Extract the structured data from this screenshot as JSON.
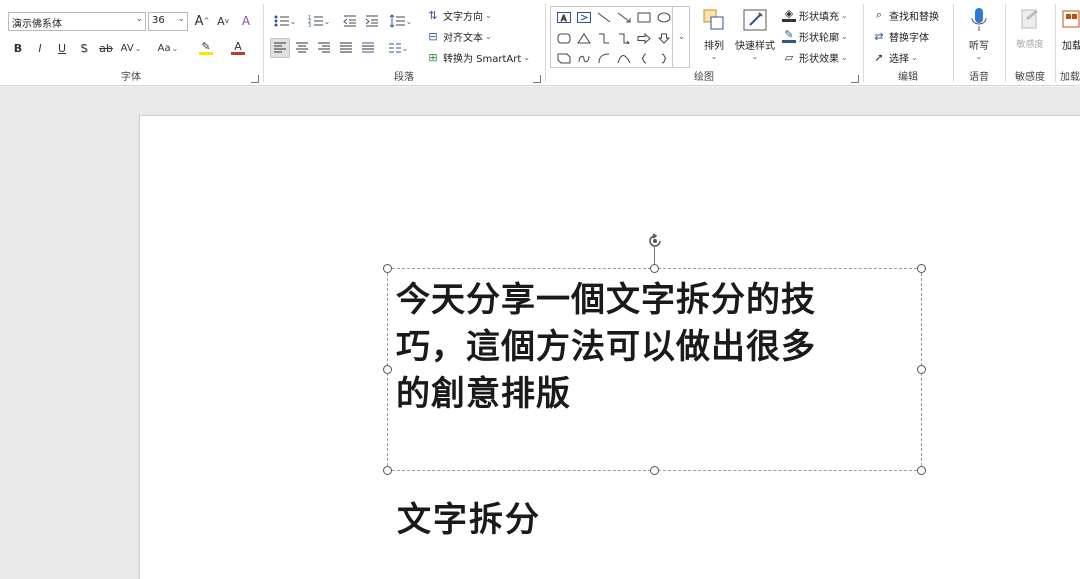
{
  "ribbon": {
    "font": {
      "label": "字体",
      "font_name": "演示佛系体",
      "font_size": "36",
      "grow": "A",
      "shrink": "A",
      "clear": "A",
      "bold": "B",
      "italic": "I",
      "underline": "U",
      "shadow": "S",
      "strike": "ab",
      "spacing": "AV",
      "case": "Aa",
      "highlight": "A",
      "color": "A"
    },
    "paragraph": {
      "label": "段落",
      "text_direction": "文字方向",
      "align_text": "对齐文本",
      "smartart": "转换为 SmartArt"
    },
    "drawing": {
      "label": "绘图",
      "arrange": "排列",
      "quick_styles": "快速样式",
      "shape_fill": "形状填充",
      "shape_outline": "形状轮廓",
      "shape_effects": "形状效果"
    },
    "editing": {
      "label": "编辑",
      "find_replace": "查找和替换",
      "replace_font": "替换字体",
      "select": "选择"
    },
    "voice": {
      "label": "语音",
      "dictate": "听写"
    },
    "sensitivity": {
      "label": "敏感度",
      "button": "敏感度"
    },
    "addins": {
      "label": "加载项",
      "button": "加载项"
    }
  },
  "slide": {
    "textbox_lines": [
      "今天分享一個文字拆分的技",
      "巧，這個方法可以做出很多",
      "的創意排版"
    ],
    "caption": "文字拆分"
  }
}
